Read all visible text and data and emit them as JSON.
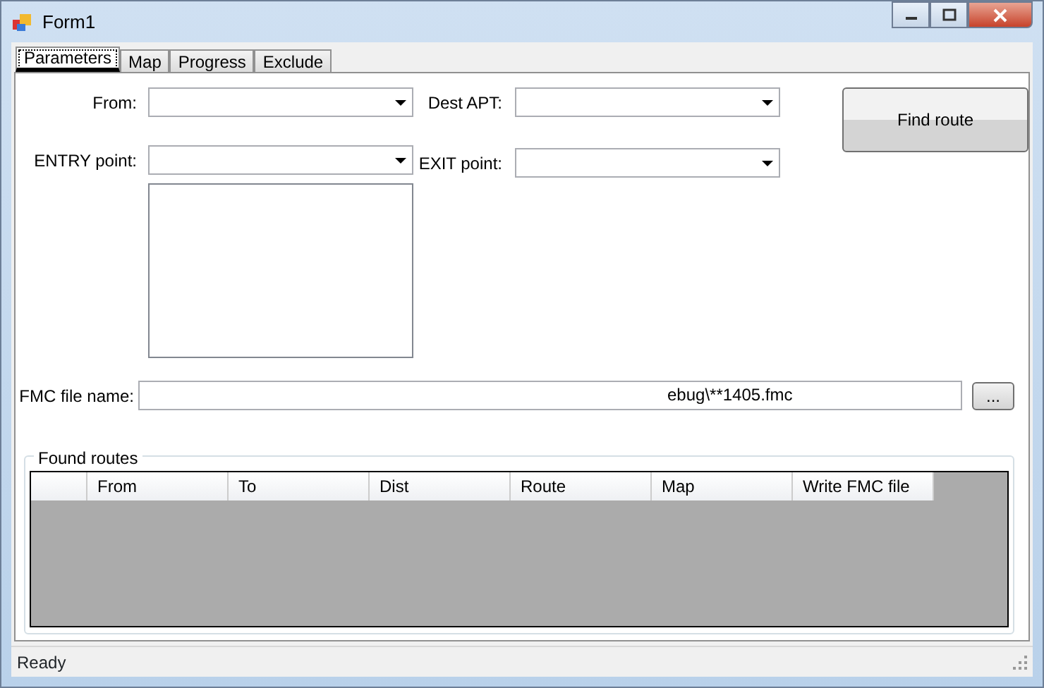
{
  "window": {
    "title": "Form1"
  },
  "tabs": [
    {
      "label": "Parameters",
      "selected": true
    },
    {
      "label": "Map",
      "selected": false
    },
    {
      "label": "Progress",
      "selected": false
    },
    {
      "label": "Exclude",
      "selected": false
    }
  ],
  "fields": {
    "from_label": "From:",
    "dest_label": "Dest APT:",
    "entry_label": "ENTRY point:",
    "exit_label": "EXIT point:",
    "find_button": "Find route",
    "fmc_label": "FMC file name:",
    "fmc_value": "ebug\\**1405.fmc",
    "browse_button": "..."
  },
  "found_routes": {
    "title": "Found routes",
    "columns": [
      "From",
      "To",
      "Dist",
      "Route",
      "Map",
      "Write FMC file"
    ]
  },
  "status_bar": {
    "text": "Ready"
  }
}
